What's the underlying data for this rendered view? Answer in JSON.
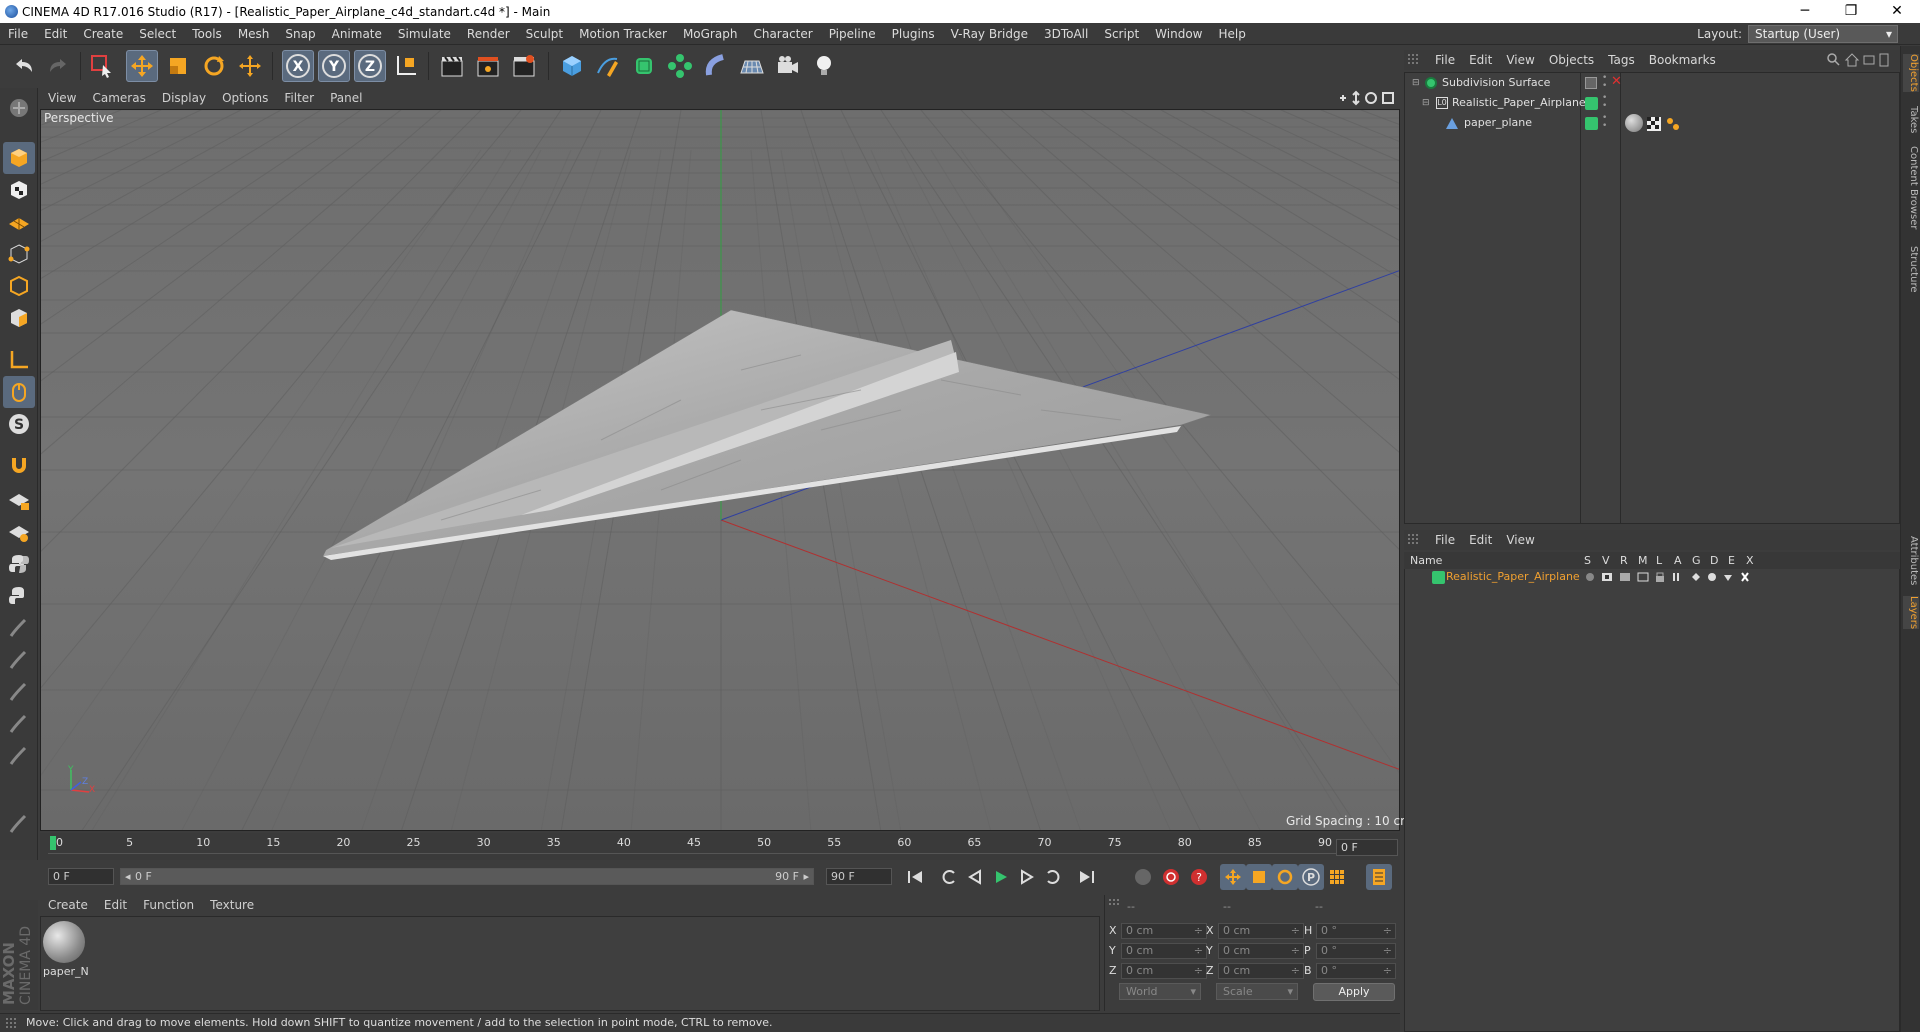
{
  "window": {
    "title": "CINEMA 4D R17.016 Studio (R17) - [Realistic_Paper_Airplane_c4d_standart.c4d *] - Main",
    "minimize": "─",
    "maximize": "❐",
    "close": "✕"
  },
  "menu": [
    "File",
    "Edit",
    "Create",
    "Select",
    "Tools",
    "Mesh",
    "Snap",
    "Animate",
    "Simulate",
    "Render",
    "Sculpt",
    "Motion Tracker",
    "MoGraph",
    "Character",
    "Pipeline",
    "Plugins",
    "V-Ray Bridge",
    "3DToAll",
    "Script",
    "Window",
    "Help"
  ],
  "layout": {
    "label": "Layout:",
    "value": "Startup (User)"
  },
  "viewport": {
    "menu": [
      "View",
      "Cameras",
      "Display",
      "Options",
      "Filter",
      "Panel"
    ],
    "label": "Perspective",
    "grid_spacing": "Grid Spacing : 10 cm",
    "axis_y": "Y",
    "axis_x": "X",
    "axis_z": "Z"
  },
  "timeline": {
    "ticks": [
      "0",
      "5",
      "10",
      "15",
      "20",
      "25",
      "30",
      "35",
      "40",
      "45",
      "50",
      "55",
      "60",
      "65",
      "70",
      "75",
      "80",
      "85",
      "90"
    ],
    "current_frame": "0 F"
  },
  "playback": {
    "start": "0 F",
    "range_start": "0 F",
    "range_end": "90 F",
    "end": "90 F"
  },
  "material_manager": {
    "menu": [
      "Create",
      "Edit",
      "Function",
      "Texture"
    ],
    "material_name": "paper_N"
  },
  "coordinates": {
    "headers": [
      "--",
      "--",
      "--"
    ],
    "rows": [
      {
        "a": "X",
        "av": "0 cm",
        "b": "X",
        "bv": "0 cm",
        "c": "H",
        "cv": "0 °"
      },
      {
        "a": "Y",
        "av": "0 cm",
        "b": "Y",
        "bv": "0 cm",
        "c": "P",
        "cv": "0 °"
      },
      {
        "a": "Z",
        "av": "0 cm",
        "b": "Z",
        "bv": "0 cm",
        "c": "B",
        "cv": "0 °"
      }
    ],
    "space": "World",
    "mode": "Scale",
    "apply": "Apply"
  },
  "status": "Move: Click and drag to move elements. Hold down SHIFT to quantize movement / add to the selection in point mode, CTRL to remove.",
  "object_manager": {
    "menu": [
      "File",
      "Edit",
      "View",
      "Objects",
      "Tags",
      "Bookmarks"
    ],
    "objects": [
      {
        "name": "Subdivision Surface"
      },
      {
        "name": "Realistic_Paper_Airplane"
      },
      {
        "name": "paper_plane"
      }
    ]
  },
  "layer_manager": {
    "menu": [
      "File",
      "Edit",
      "View"
    ],
    "header_name": "Name",
    "header_cols": [
      "S",
      "V",
      "R",
      "M",
      "L",
      "A",
      "G",
      "D",
      "E",
      "X"
    ],
    "layers": [
      {
        "name": "Realistic_Paper_Airplane",
        "color": "#35c46e"
      }
    ]
  },
  "side_tabs": [
    "Objects",
    "Takes",
    "Content Browser",
    "Structure",
    "Attributes",
    "Layers"
  ],
  "colors": {
    "accent": "#f0a030",
    "layer_green": "#35c46e",
    "selected_tool": "#5a6a7e"
  }
}
